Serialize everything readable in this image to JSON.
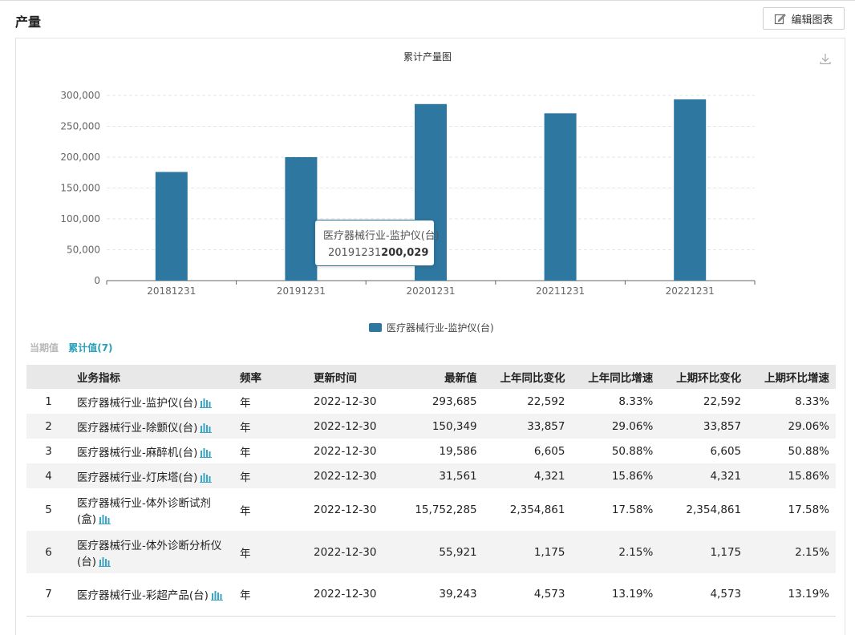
{
  "page": {
    "title": "产量",
    "edit_label": "编辑图表"
  },
  "chart_data": {
    "type": "bar",
    "title": "累计产量图",
    "categories": [
      "20181231",
      "20191231",
      "20201231",
      "20211231",
      "20221231"
    ],
    "series": [
      {
        "name": "医疗器械行业-监护仪(台)",
        "values": [
          176000,
          200029,
          286000,
          271000,
          293685
        ],
        "color": "#2e77a1"
      }
    ],
    "ylim": [
      0,
      300000
    ],
    "yticks": [
      "0",
      "50,000",
      "100,000",
      "150,000",
      "200,000",
      "250,000",
      "300,000"
    ],
    "grid": true,
    "legend_position": "bottom"
  },
  "tooltip": {
    "series": "医疗器械行业-监护仪(台)",
    "category": "20191231",
    "value": "200,029"
  },
  "toggle": {
    "current_label": "当期值",
    "cumulative_label": "累计值(7)"
  },
  "table": {
    "headers": [
      "",
      "业务指标",
      "频率",
      "更新时间",
      "最新值",
      "上年同比变化",
      "上年同比增速",
      "上期环比变化",
      "上期环比增速"
    ],
    "rows": [
      {
        "idx": "1",
        "name": "医疗器械行业-监护仪(台)",
        "freq": "年",
        "time": "2022-12-30",
        "latest": "293,685",
        "yoy_change": "22,592",
        "yoy_rate": "8.33%",
        "mom_change": "22,592",
        "mom_rate": "8.33%"
      },
      {
        "idx": "2",
        "name": "医疗器械行业-除颤仪(台)",
        "freq": "年",
        "time": "2022-12-30",
        "latest": "150,349",
        "yoy_change": "33,857",
        "yoy_rate": "29.06%",
        "mom_change": "33,857",
        "mom_rate": "29.06%"
      },
      {
        "idx": "3",
        "name": "医疗器械行业-麻醉机(台)",
        "freq": "年",
        "time": "2022-12-30",
        "latest": "19,586",
        "yoy_change": "6,605",
        "yoy_rate": "50.88%",
        "mom_change": "6,605",
        "mom_rate": "50.88%"
      },
      {
        "idx": "4",
        "name": "医疗器械行业-灯床塔(台)",
        "freq": "年",
        "time": "2022-12-30",
        "latest": "31,561",
        "yoy_change": "4,321",
        "yoy_rate": "15.86%",
        "mom_change": "4,321",
        "mom_rate": "15.86%"
      },
      {
        "idx": "5",
        "name": "医疗器械行业-体外诊断试剂(盒)",
        "freq": "年",
        "time": "2022-12-30",
        "latest": "15,752,285",
        "yoy_change": "2,354,861",
        "yoy_rate": "17.58%",
        "mom_change": "2,354,861",
        "mom_rate": "17.58%"
      },
      {
        "idx": "6",
        "name": "医疗器械行业-体外诊断分析仪(台)",
        "freq": "年",
        "time": "2022-12-30",
        "latest": "55,921",
        "yoy_change": "1,175",
        "yoy_rate": "2.15%",
        "mom_change": "1,175",
        "mom_rate": "2.15%"
      },
      {
        "idx": "7",
        "name": "医疗器械行业-彩超产品(台)",
        "freq": "年",
        "time": "2022-12-30",
        "latest": "39,243",
        "yoy_change": "4,573",
        "yoy_rate": "13.19%",
        "mom_change": "4,573",
        "mom_rate": "13.19%"
      }
    ]
  },
  "icons": {
    "edit": "edit-icon",
    "download": "download-icon",
    "chart": "bar-chart-icon"
  }
}
